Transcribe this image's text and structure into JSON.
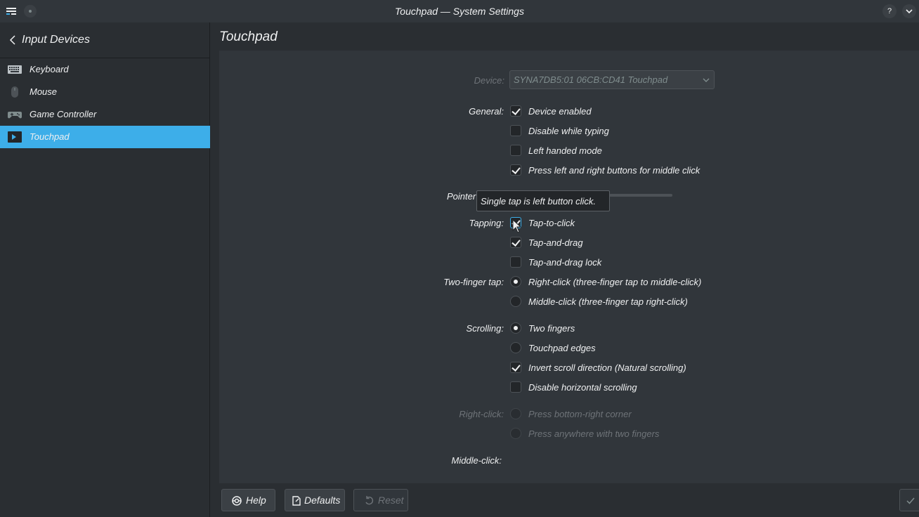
{
  "window": {
    "title": "Touchpad — System Settings"
  },
  "sidebar": {
    "header": "Input Devices",
    "items": [
      {
        "label": "Keyboard",
        "icon": "keyboard-icon"
      },
      {
        "label": "Mouse",
        "icon": "mouse-icon"
      },
      {
        "label": "Game Controller",
        "icon": "gamepad-icon"
      },
      {
        "label": "Touchpad",
        "icon": "touchpad-icon",
        "active": true
      }
    ]
  },
  "page": {
    "title": "Touchpad",
    "device": {
      "label": "Device:",
      "value": "SYNA7DB5:01 06CB:CD41 Touchpad"
    },
    "general": {
      "label": "General:",
      "options": [
        {
          "label": "Device enabled",
          "checked": true
        },
        {
          "label": "Disable while typing",
          "checked": false
        },
        {
          "label": "Left handed mode",
          "checked": false
        },
        {
          "label": "Press left and right buttons for middle click",
          "checked": true
        }
      ]
    },
    "pointer": {
      "label": "Pointer"
    },
    "tooltip": "Single tap is left button click.",
    "tapping": {
      "label": "Tapping:",
      "options": [
        {
          "label": "Tap-to-click",
          "checked": true
        },
        {
          "label": "Tap-and-drag",
          "checked": true
        },
        {
          "label": "Tap-and-drag lock",
          "checked": false
        }
      ]
    },
    "two_finger_tap": {
      "label": "Two-finger tap:",
      "options": [
        {
          "label": "Right-click (three-finger tap to middle-click)",
          "selected": true
        },
        {
          "label": "Middle-click (three-finger tap right-click)",
          "selected": false
        }
      ]
    },
    "scrolling": {
      "label": "Scrolling:",
      "options": [
        {
          "label": "Two fingers",
          "selected": true
        },
        {
          "label": "Touchpad edges",
          "selected": false
        }
      ],
      "checks": [
        {
          "label": "Invert scroll direction (Natural scrolling)",
          "checked": true
        },
        {
          "label": "Disable horizontal scrolling",
          "checked": false
        }
      ]
    },
    "right_click": {
      "label": "Right-click:",
      "options": [
        {
          "label": "Press bottom-right corner"
        },
        {
          "label": "Press anywhere with two fingers"
        }
      ]
    },
    "middle_click": {
      "label": "Middle-click:"
    }
  },
  "footer": {
    "help": "Help",
    "defaults": "Defaults",
    "reset": "Reset"
  },
  "colors": {
    "accent": "#3daee9",
    "background": "#2a2e32",
    "panel": "#31363b"
  }
}
